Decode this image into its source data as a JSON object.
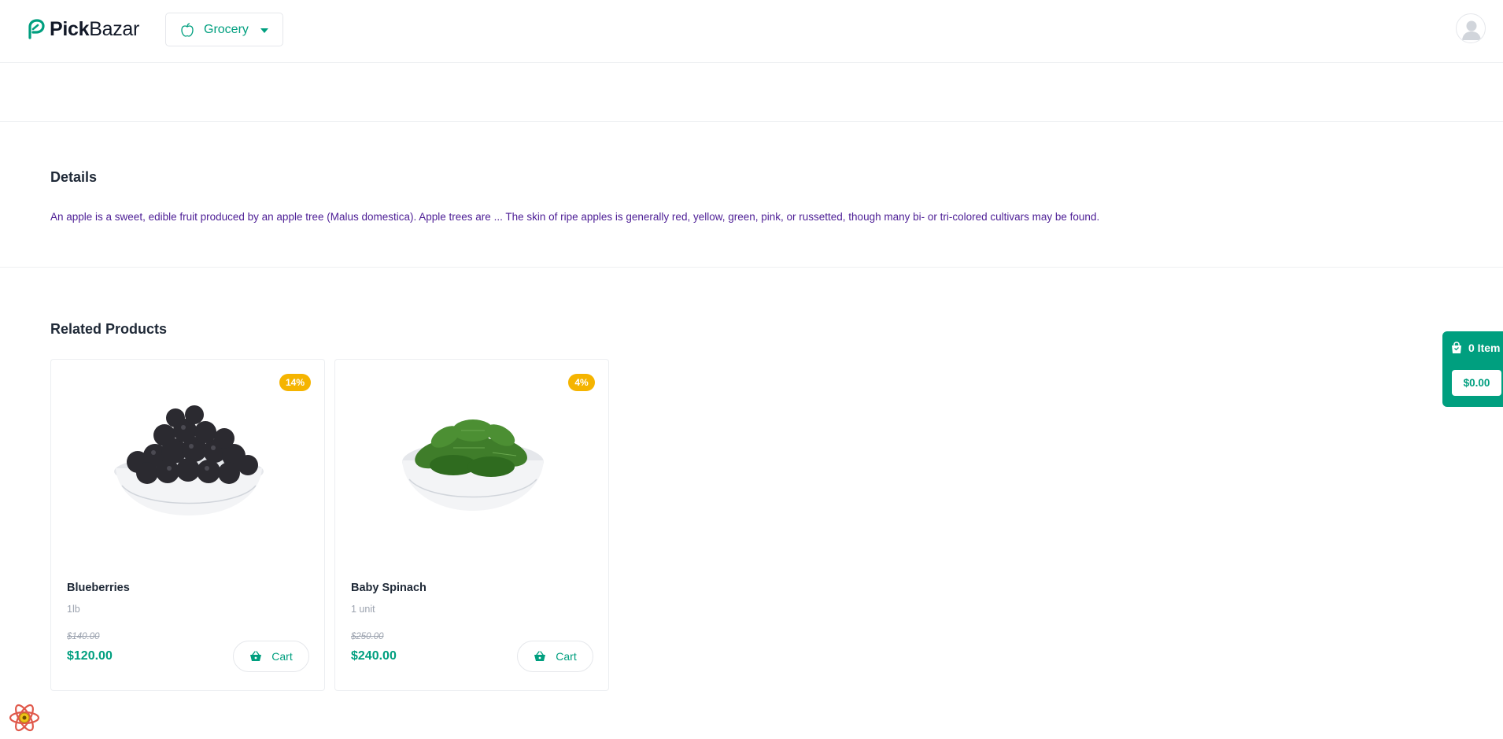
{
  "header": {
    "logo_bold": "Pick",
    "logo_light": "Bazar",
    "category_label": "Grocery"
  },
  "details": {
    "title": "Details",
    "text": "An apple is a sweet, edible fruit produced by an apple tree (Malus domestica). Apple trees are ... The skin of ripe apples is generally red, yellow, green, pink, or russetted, though many bi- or tri-colored cultivars may be found."
  },
  "related": {
    "title": "Related Products",
    "products": [
      {
        "name": "Blueberries",
        "unit": "1lb",
        "badge": "14%",
        "old_price": "$140.00",
        "price": "$120.00",
        "cart_label": "Cart",
        "image_icon": "blackberry-bowl-image"
      },
      {
        "name": "Baby Spinach",
        "unit": "1 unit",
        "badge": "4%",
        "old_price": "$250.00",
        "price": "$240.00",
        "cart_label": "Cart",
        "image_icon": "spinach-bowl-image"
      }
    ]
  },
  "cart_float": {
    "items": "0 Item",
    "total": "$0.00"
  },
  "colors": {
    "accent": "#009f7f",
    "badge": "#f5b400",
    "details_text": "#4c1d95"
  }
}
